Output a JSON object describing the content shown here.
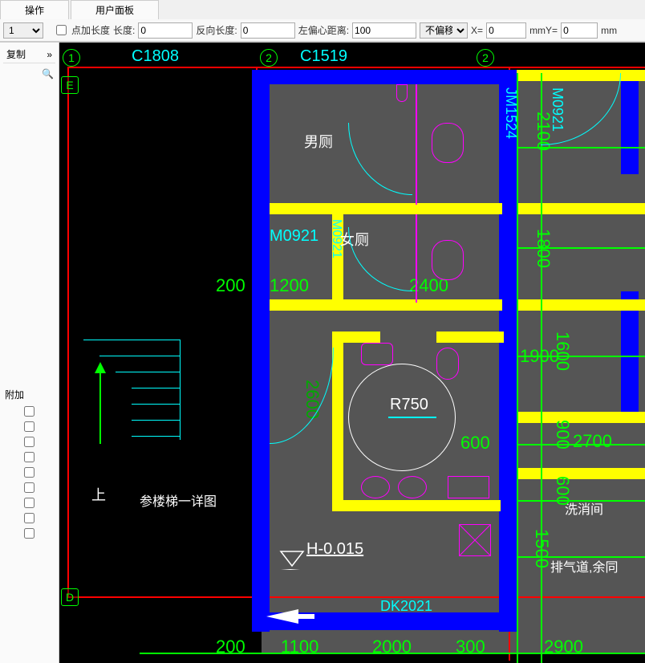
{
  "tabs": {
    "op": "操作",
    "panel": "用户面板"
  },
  "params": {
    "dropdown1": "1",
    "chk_label": "点加长度",
    "len_label": "长度:",
    "len_val": "0",
    "rev_label": "反向长度:",
    "rev_val": "0",
    "left_label": "左偏心距离:",
    "left_val": "100",
    "offset_sel": "不偏移",
    "x_label": "X=",
    "x_val": "0",
    "y_label": "mmY=",
    "y_val": "0",
    "unit": "mm"
  },
  "side": {
    "copy": "复制",
    "attach": "附加"
  },
  "drawing": {
    "axis": {
      "n1": "1",
      "n2": "2",
      "n2b": "2",
      "e": "E",
      "d": "D"
    },
    "ref": {
      "c1808": "C1808",
      "c1519": "C1519",
      "m0921": "M0921",
      "m0921b": "M0921",
      "m09": "M0921",
      "jm": "JM1524",
      "dk2021": "DK2021"
    },
    "rooms": {
      "male": "男厕",
      "female": "女厕",
      "up": "上",
      "stair": "参楼梯一详图",
      "wash": "洗消间",
      "duct": "排气道,余同"
    },
    "dims": {
      "d200a": "200",
      "d1200": "1200",
      "d2400": "2400",
      "d2100": "2100",
      "d1800": "1800",
      "d1900": "1900",
      "d1600": "1600",
      "d2700": "2700",
      "d900": "900",
      "d600": "600",
      "d1500": "1500",
      "d600b": "600",
      "d200b": "200",
      "d1100": "1100",
      "d2000": "2000",
      "d300": "300",
      "d2900": "2900",
      "d2600": "2600"
    },
    "radius": "R750",
    "level": "H-0.015"
  }
}
